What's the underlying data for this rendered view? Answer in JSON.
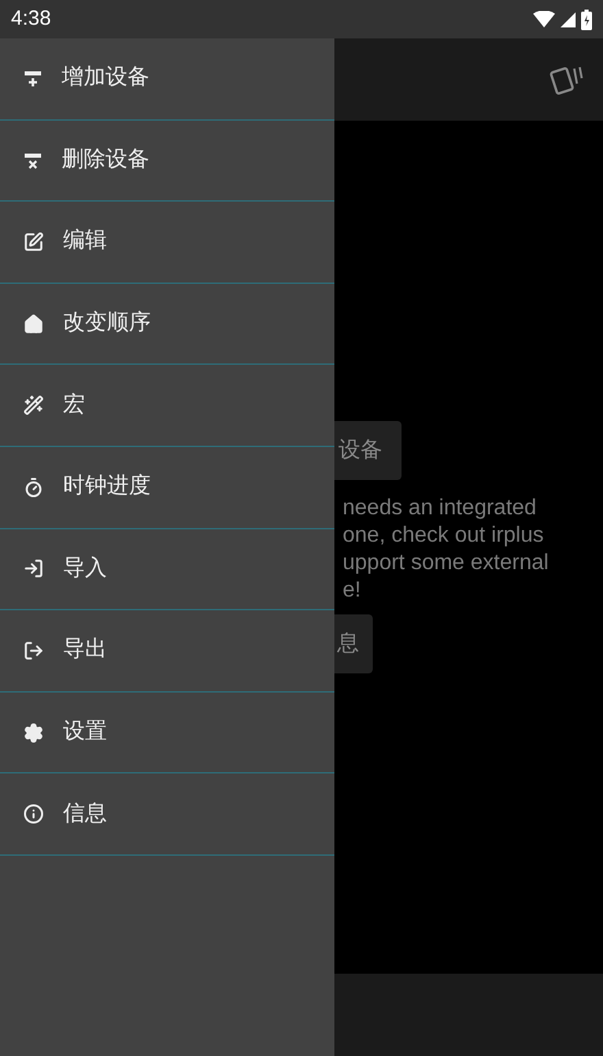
{
  "status_bar": {
    "time": "4:38"
  },
  "drawer": {
    "items": [
      {
        "label": "增加设备"
      },
      {
        "label": "删除设备"
      },
      {
        "label": "编辑"
      },
      {
        "label": "改变顺序"
      },
      {
        "label": "宏"
      },
      {
        "label": "时钟进度"
      },
      {
        "label": "导入"
      },
      {
        "label": "导出"
      },
      {
        "label": "设置"
      },
      {
        "label": "信息"
      }
    ]
  },
  "content": {
    "top_button": "设备",
    "message_lines": [
      "needs an integrated",
      "one, check out irplus",
      "upport some external",
      "e!"
    ],
    "bottom_button": "息"
  }
}
